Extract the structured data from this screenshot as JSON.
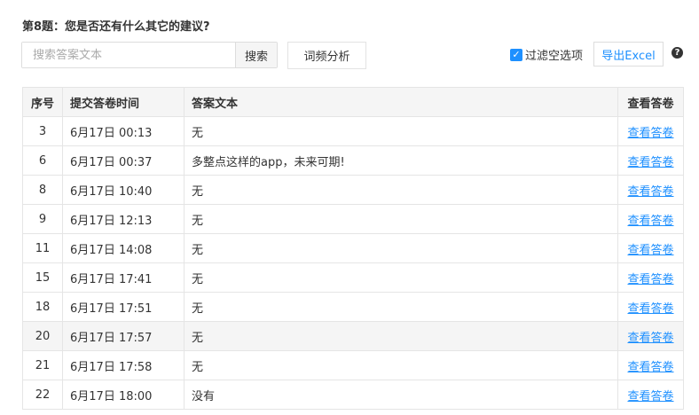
{
  "question": "第8题：您是否还有什么其它的建议?",
  "search": {
    "placeholder": "搜索答案文本",
    "button": "搜索"
  },
  "freq_button": "词频分析",
  "filter_label": "过滤空选项",
  "filter_checked": true,
  "export_button": "导出Excel",
  "help_icon": "?",
  "headers": [
    "序号",
    "提交答卷时间",
    "答案文本",
    "查看答卷"
  ],
  "rows": [
    {
      "no": "3",
      "time": "6月17日 00:13",
      "text": "无",
      "link": "查看答卷"
    },
    {
      "no": "6",
      "time": "6月17日 00:37",
      "text": "多整点这样的app，未来可期!",
      "link": "查看答卷"
    },
    {
      "no": "8",
      "time": "6月17日 10:40",
      "text": "无",
      "link": "查看答卷"
    },
    {
      "no": "9",
      "time": "6月17日 12:13",
      "text": "无",
      "link": "查看答卷"
    },
    {
      "no": "11",
      "time": "6月17日 14:08",
      "text": "无",
      "link": "查看答卷"
    },
    {
      "no": "15",
      "time": "6月17日 17:41",
      "text": "无",
      "link": "查看答卷"
    },
    {
      "no": "18",
      "time": "6月17日 17:51",
      "text": "无",
      "link": "查看答卷"
    },
    {
      "no": "20",
      "time": "6月17日 17:57",
      "text": "无",
      "link": "查看答卷"
    },
    {
      "no": "21",
      "time": "6月17日 17:58",
      "text": "无",
      "link": "查看答卷"
    },
    {
      "no": "22",
      "time": "6月17日 18:00",
      "text": "没有",
      "link": "查看答卷"
    }
  ]
}
